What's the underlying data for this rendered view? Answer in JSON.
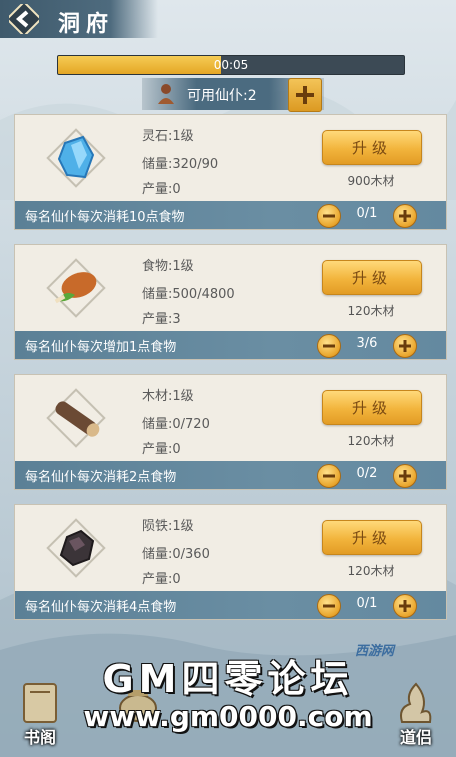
{
  "header": {
    "title": "洞府"
  },
  "timer": {
    "text": "00:05",
    "progress": 0.47
  },
  "servants": {
    "label": "可用仙仆:2"
  },
  "upgrade_label": "升级",
  "buildings": [
    {
      "name": "灵石:1级",
      "storage": "储量:320/90",
      "output": "产量:0",
      "cost": "900木材",
      "note": "每名仙仆每次消耗10点食物",
      "count": "0/1",
      "icon": "spirit-stone-icon"
    },
    {
      "name": "食物:1级",
      "storage": "储量:500/4800",
      "output": "产量:3",
      "cost": "120木材",
      "note": "每名仙仆每次增加1点食物",
      "count": "3/6",
      "icon": "food-icon"
    },
    {
      "name": "木材:1级",
      "storage": "储量:0/720",
      "output": "产量:0",
      "cost": "120木材",
      "note": "每名仙仆每次消耗2点食物",
      "count": "0/2",
      "icon": "wood-icon"
    },
    {
      "name": "陨铁:1级",
      "storage": "储量:0/360",
      "output": "产量:0",
      "cost": "120木材",
      "note": "每名仙仆每次消耗4点食物",
      "count": "0/1",
      "icon": "meteor-iron-icon"
    }
  ],
  "nav": {
    "left_label": "书阁",
    "right_label": "道侣"
  },
  "watermark": {
    "line1": "GM四零论坛",
    "line2": "www.gm0000.com",
    "small": "西游网"
  }
}
